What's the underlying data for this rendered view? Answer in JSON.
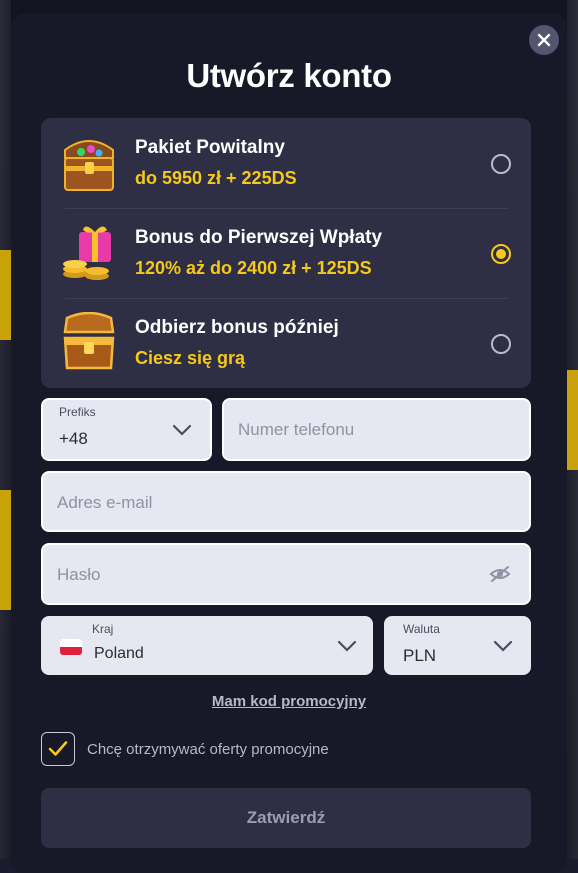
{
  "modal": {
    "title": "Utwórz konto",
    "close_icon": "close-icon"
  },
  "bonuses": [
    {
      "icon": "treasure-chest-icon",
      "name": "Pakiet Powitalny",
      "description": "do 5950 zł + 225DS",
      "selected": false
    },
    {
      "icon": "gift-coins-icon",
      "name": "Bonus do Pierwszej Wpłaty",
      "description": "120% aż do 2400 zł + 125DS",
      "selected": true
    },
    {
      "icon": "open-chest-icon",
      "name": "Odbierz bonus później",
      "description": "Ciesz się grą",
      "selected": false
    }
  ],
  "form": {
    "prefix": {
      "label": "Prefiks",
      "value": "+48"
    },
    "phone": {
      "placeholder": "Numer telefonu"
    },
    "email": {
      "placeholder": "Adres e-mail"
    },
    "password": {
      "placeholder": "Hasło",
      "icon": "eye-slash-icon"
    },
    "country": {
      "label": "Kraj",
      "value": "Poland",
      "flag": "poland-flag-icon"
    },
    "currency": {
      "label": "Waluta",
      "value": "PLN"
    }
  },
  "promo_link": "Mam kod promocyjny",
  "consent": {
    "checked": true,
    "label": "Chcę otrzymywać oferty promocyjne"
  },
  "submit_label": "Zatwierdź",
  "colors": {
    "accent": "#f5c81a",
    "modal_bg": "#171828",
    "panel_bg": "#2e2f44",
    "field_bg": "#e6e7f1"
  }
}
